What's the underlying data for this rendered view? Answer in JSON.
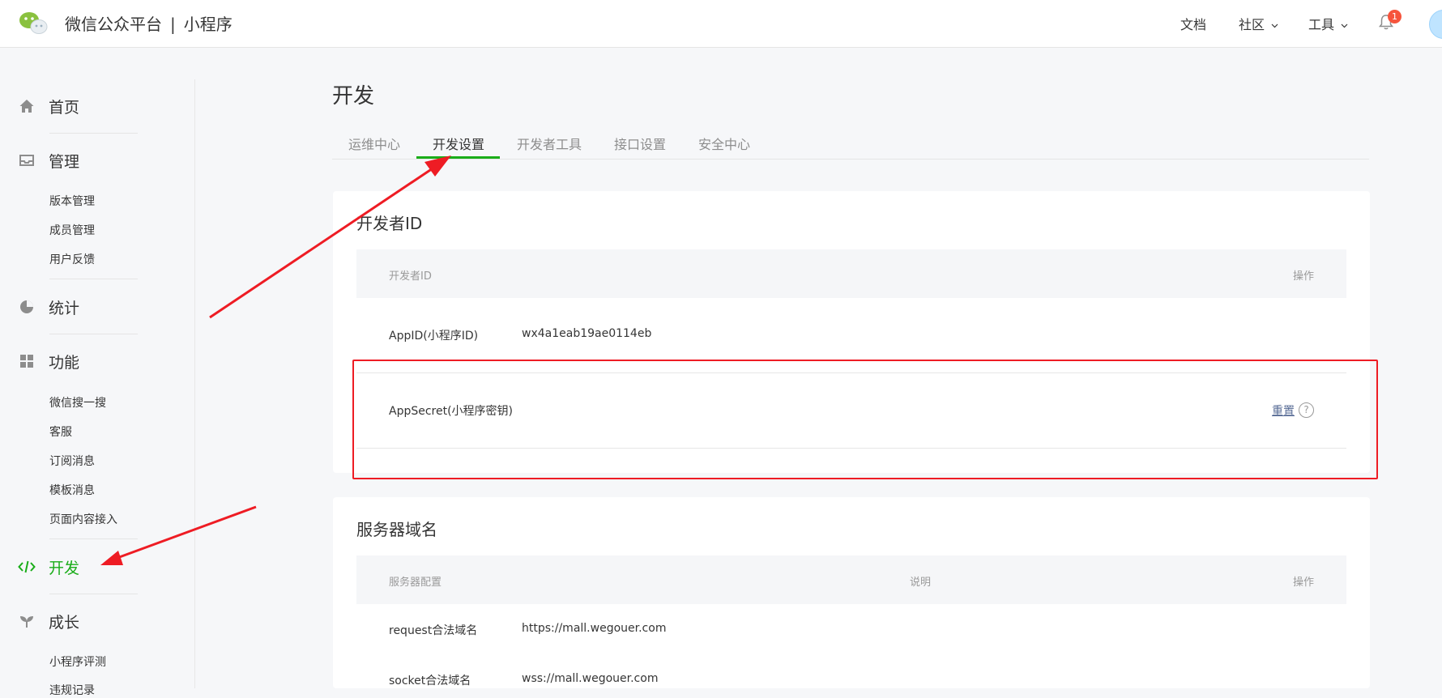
{
  "header": {
    "brand_main": "微信公众平台",
    "brand_sep": "|",
    "brand_sub": "小程序",
    "nav_docs": "文档",
    "nav_community": "社区",
    "nav_tools": "工具",
    "notification_count": "1"
  },
  "sidebar": {
    "home": "首页",
    "manage": "管理",
    "manage_items": [
      "版本管理",
      "成员管理",
      "用户反馈"
    ],
    "stats": "统计",
    "features": "功能",
    "features_items": [
      "微信搜一搜",
      "客服",
      "订阅消息",
      "模板消息",
      "页面内容接入"
    ],
    "dev": "开发",
    "growth": "成长",
    "growth_items": [
      "小程序评测",
      "违规记录"
    ]
  },
  "main": {
    "title": "开发",
    "tabs": [
      "运维中心",
      "开发设置",
      "开发者工具",
      "接口设置",
      "安全中心"
    ],
    "active_tab": "开发设置",
    "developer_id": {
      "title": "开发者ID",
      "col_id": "开发者ID",
      "col_action": "操作",
      "appid_label": "AppID(小程序ID)",
      "appid_value": "wx4a1eab19ae0114eb",
      "secret_label": "AppSecret(小程序密钥)",
      "secret_action": "重置",
      "help": "?"
    },
    "server_domain": {
      "title": "服务器域名",
      "col_config": "服务器配置",
      "col_desc": "说明",
      "col_action": "操作",
      "rows": [
        {
          "label": "request合法域名",
          "value": "https://mall.wegouer.com"
        },
        {
          "label": "socket合法域名",
          "value": "wss://mall.wegouer.com"
        }
      ]
    }
  },
  "colors": {
    "accent": "#1aad19",
    "link": "#576b95",
    "annotation": "#ee1c24",
    "badge": "#f6543c"
  }
}
